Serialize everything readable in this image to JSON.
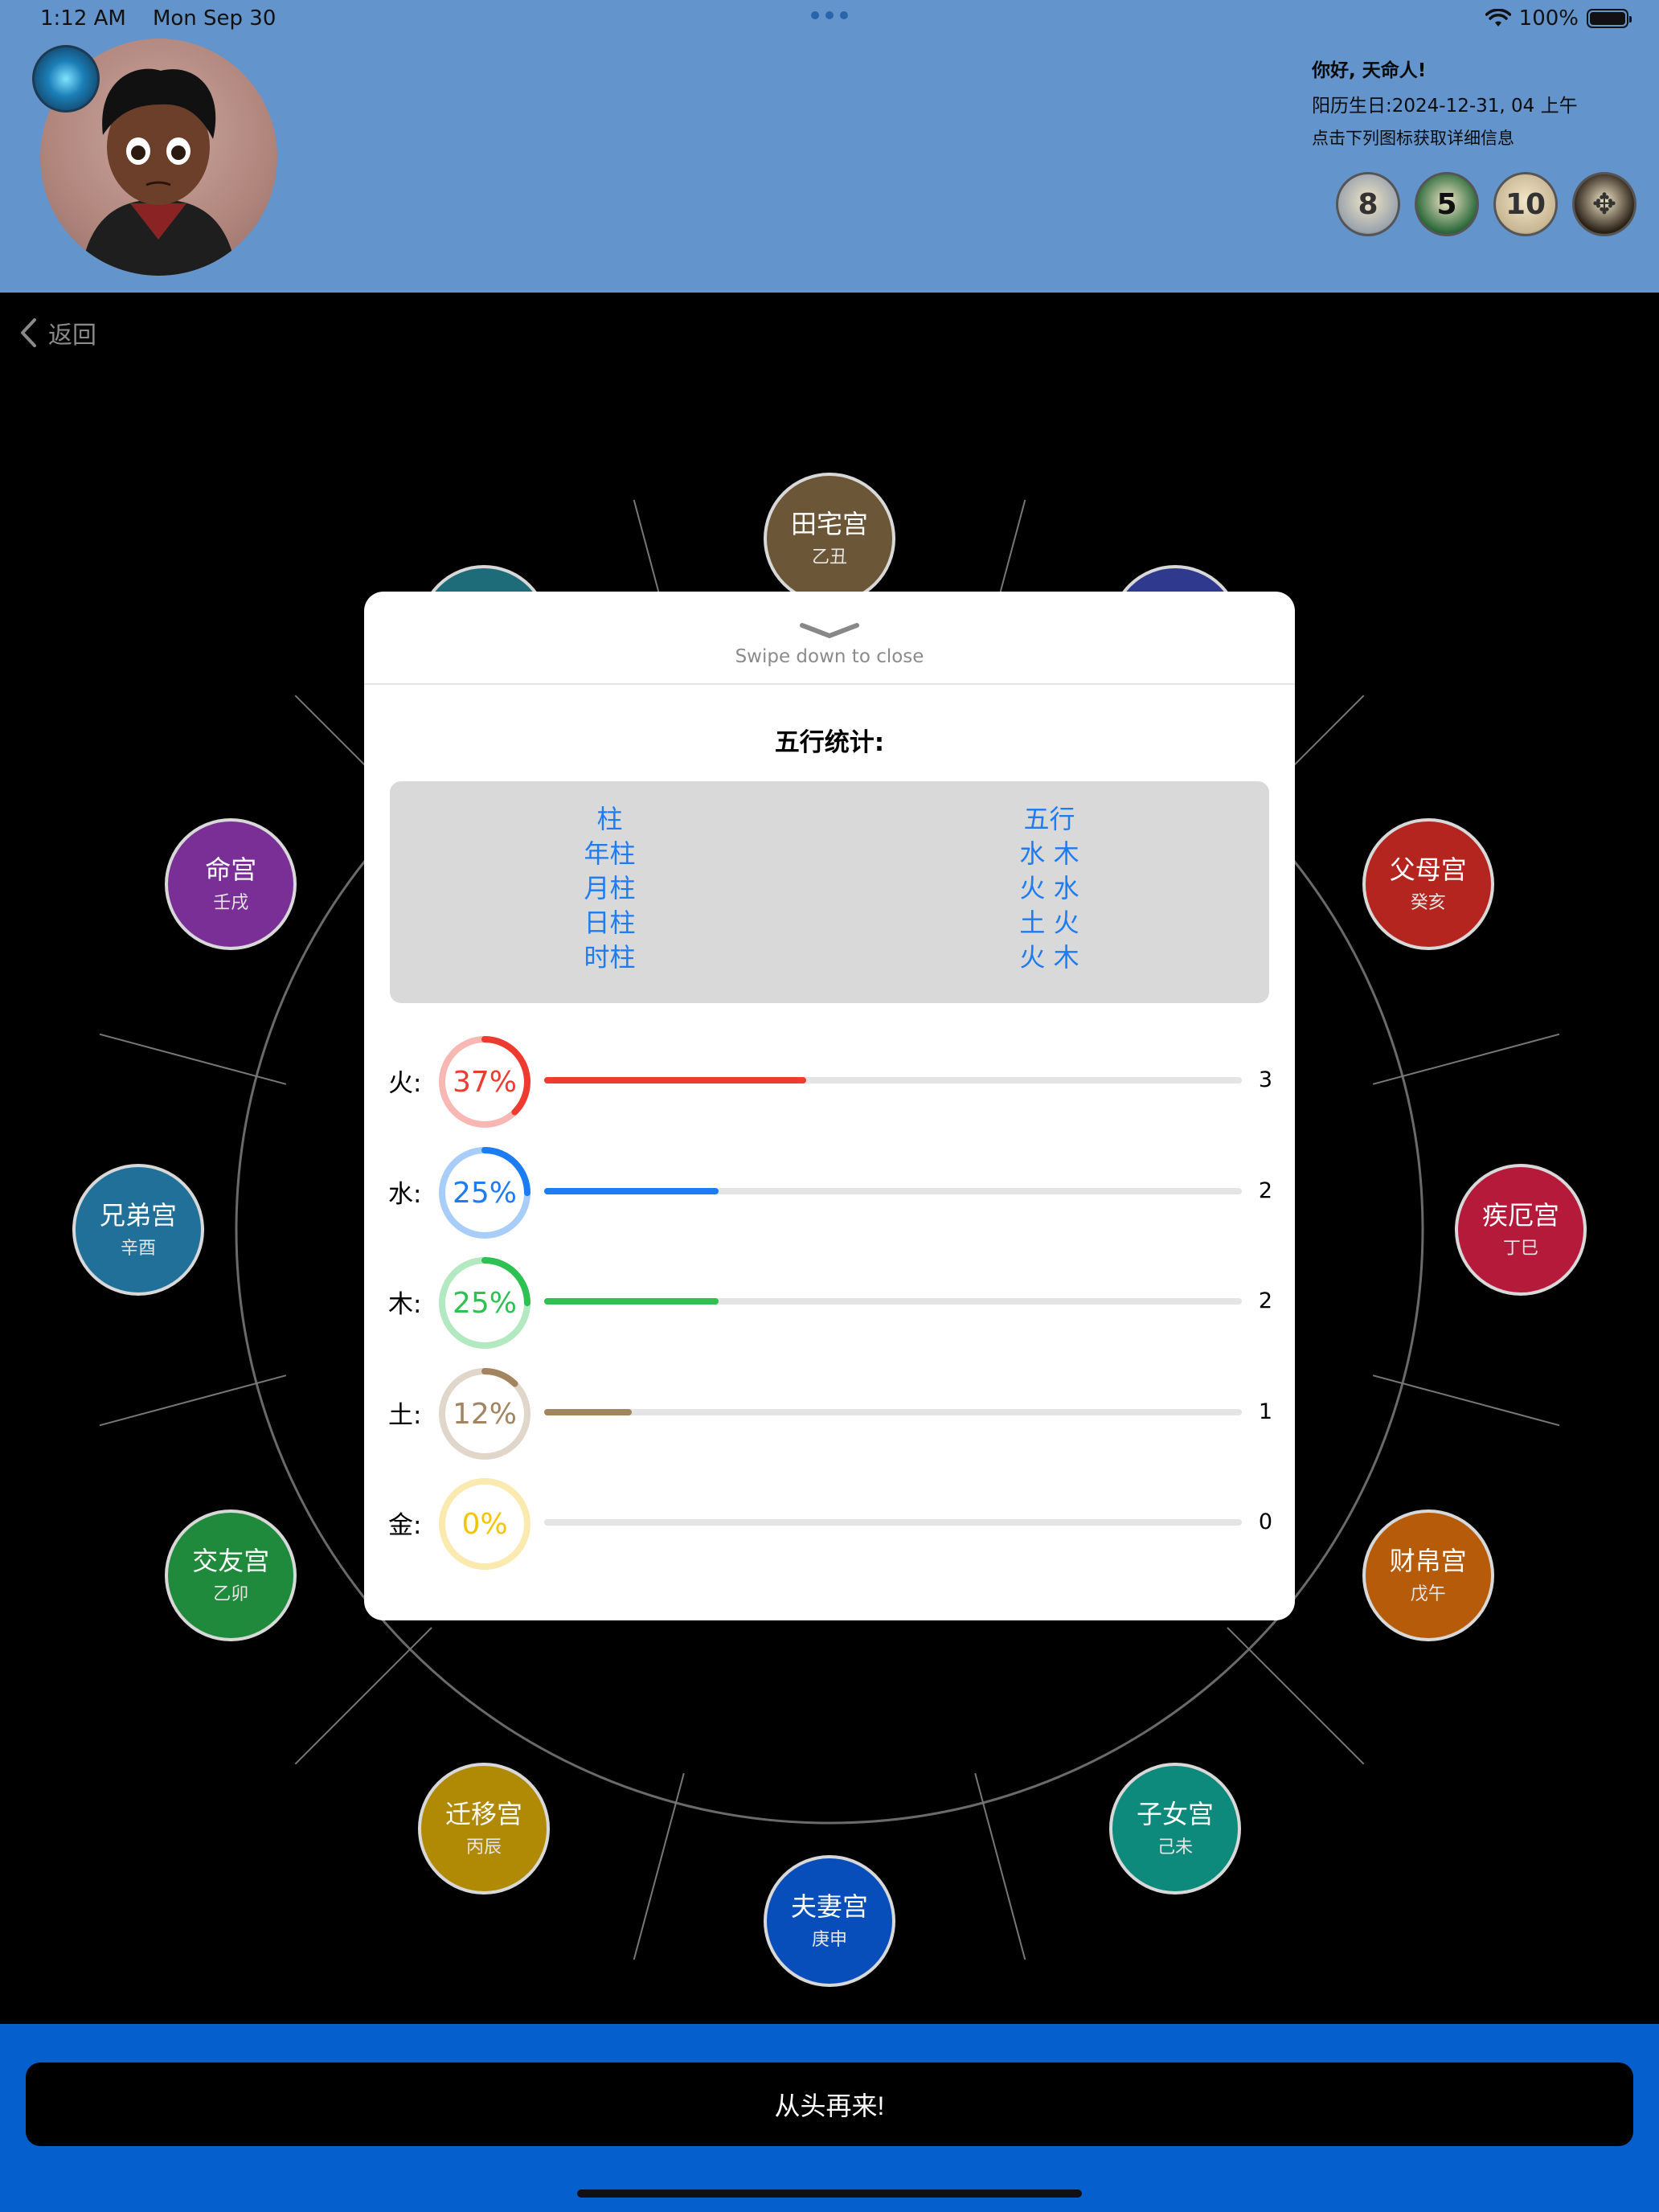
{
  "status_bar": {
    "time": "1:12 AM",
    "date": "Mon Sep 30",
    "battery": "100%"
  },
  "header": {
    "greeting": "你好, 天命人!",
    "birth": "阳历生日:2024-12-31, 04 上午",
    "hint": "点击下列图标获取详细信息",
    "feature_icons": [
      {
        "name": "number-8-icon",
        "glyph": "8",
        "color": "#9aa3ad"
      },
      {
        "name": "number-5-icon",
        "glyph": "5",
        "color": "#2b6a3a"
      },
      {
        "name": "number-10-icon",
        "glyph": "10",
        "color": "#c8b693"
      },
      {
        "name": "pattern-icon",
        "glyph": "✥",
        "color": "#2a2016"
      }
    ]
  },
  "nav": {
    "back_label": "返回"
  },
  "palaces": [
    {
      "name": "田宅宫",
      "stem": "乙丑",
      "color": "#6b5637"
    },
    {
      "name": "父母宫",
      "stem": "癸亥",
      "color": "#b3251e"
    },
    {
      "name": "疾厄宫",
      "stem": "丁巳",
      "color": "#b51a3b"
    },
    {
      "name": "财帛宫",
      "stem": "戊午",
      "color": "#b65b09"
    },
    {
      "name": "子女宫",
      "stem": "己未",
      "color": "#0e8a7c"
    },
    {
      "name": "夫妻宫",
      "stem": "庚申",
      "color": "#074ebb"
    },
    {
      "name": "迁移宫",
      "stem": "丙辰",
      "color": "#b18a05"
    },
    {
      "name": "交友宫",
      "stem": "乙卯",
      "color": "#1f8a3b"
    },
    {
      "name": "兄弟宫",
      "stem": "辛酉",
      "color": "#21709a"
    },
    {
      "name": "命宫",
      "stem": "壬戌",
      "color": "#7a2f97"
    }
  ],
  "sheet": {
    "swipe_hint": "Swipe down to close",
    "title": "五行统计:",
    "table": {
      "headers": [
        "柱",
        "五行"
      ],
      "rows": [
        [
          "年柱",
          "水 木"
        ],
        [
          "月柱",
          "火 水"
        ],
        [
          "日柱",
          "土 火"
        ],
        [
          "时柱",
          "火 木"
        ]
      ]
    },
    "elements": [
      {
        "label": "火:",
        "percent_text": "37%",
        "fraction": 0.375,
        "count": "3",
        "color": "#ef3b2f",
        "light": "#f8b7b2"
      },
      {
        "label": "水:",
        "percent_text": "25%",
        "fraction": 0.25,
        "count": "2",
        "color": "#1c7cf2",
        "light": "#a9cdf9"
      },
      {
        "label": "木:",
        "percent_text": "25%",
        "fraction": 0.25,
        "count": "2",
        "color": "#2fc052",
        "light": "#b2e9c0"
      },
      {
        "label": "土:",
        "percent_text": "12%",
        "fraction": 0.125,
        "count": "1",
        "color": "#a2845f",
        "light": "#e0d6c9"
      },
      {
        "label": "金:",
        "percent_text": "0%",
        "fraction": 0,
        "count": "0",
        "color": "#f5c400",
        "light": "#fbeab0"
      }
    ]
  },
  "footer": {
    "restart_label": "从头再来!"
  }
}
